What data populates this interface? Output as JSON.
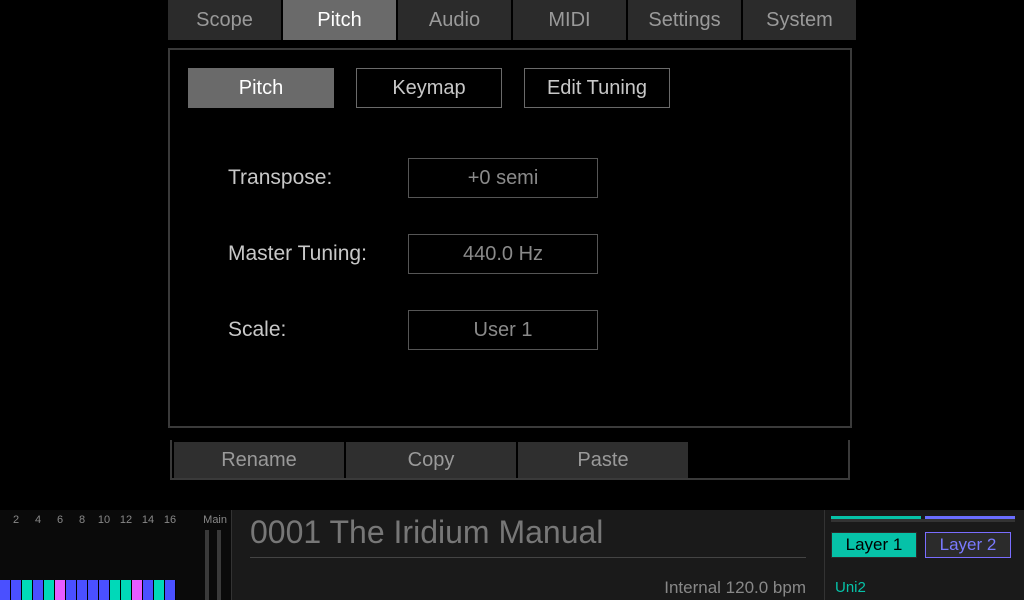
{
  "topTabs": [
    "Scope",
    "Pitch",
    "Audio",
    "MIDI",
    "Settings",
    "System"
  ],
  "topTabActive": 1,
  "subTabs": [
    "Pitch",
    "Keymap",
    "Edit Tuning"
  ],
  "subTabActive": 0,
  "params": {
    "transpose": {
      "label": "Transpose:",
      "value": "+0 semi"
    },
    "masterTuning": {
      "label": "Master Tuning:",
      "value": "440.0 Hz"
    },
    "scale": {
      "label": "Scale:",
      "value": "User 1"
    }
  },
  "actions": [
    "Rename",
    "Copy",
    "Paste"
  ],
  "midiChannels": [
    "2",
    "4",
    "6",
    "8",
    "10",
    "12",
    "14",
    "16"
  ],
  "midiMainLabel": "Main",
  "midiBarColors": [
    "#4a50ff",
    "#4a50ff",
    "#00d9b8",
    "#4a50ff",
    "#00d9b8",
    "#e65cff",
    "#4a50ff",
    "#4a50ff",
    "#4a50ff",
    "#4a50ff",
    "#00d9b8",
    "#00d9b8",
    "#e65cff",
    "#4a50ff",
    "#00d9b8",
    "#4a50ff"
  ],
  "preset": {
    "name": "0001 The Iridium Manual",
    "tempo": "Internal 120.0 bpm"
  },
  "layers": {
    "l1": "Layer 1",
    "l2": "Layer 2",
    "uni": "Uni2"
  }
}
